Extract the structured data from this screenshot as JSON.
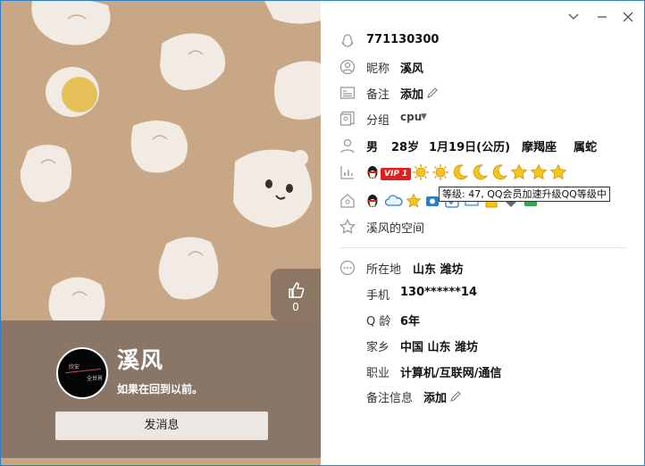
{
  "profile": {
    "qq_number": "771130300",
    "nickname_label": "昵称",
    "nickname": "溪风",
    "remark_label": "备注",
    "remark_action": "添加",
    "group_label": "分组",
    "group_value": "cpu",
    "gender": "男",
    "age": "28岁",
    "birthday": "1月19日(公历)",
    "zodiac": "摩羯座",
    "chinese_zodiac": "属蛇",
    "vip_badge": "VIP 1",
    "level_tooltip": "等级: 47, QQ会员加速升级QQ等级中",
    "space_link": "溪风的空间"
  },
  "details": {
    "location_label": "所在地",
    "location": "山东 潍坊",
    "phone_label": "手机",
    "phone": "130******14",
    "qage_label": "Q 龄",
    "qage": "6年",
    "hometown_label": "家乡",
    "hometown": "中国 山东 潍坊",
    "job_label": "职业",
    "job": "计算机/互联网/通信",
    "note_label": "备注信息",
    "note_action": "添加"
  },
  "card": {
    "nickname": "溪风",
    "signature": "如果在回到以前。",
    "send_button": "发消息",
    "like_count": "0",
    "avatar_text_1": "欣安",
    "avatar_text_2": "全世界"
  },
  "level_icons": [
    "sun-icon",
    "sun-icon",
    "moon-icon",
    "moon-icon",
    "moon-icon",
    "star-icon",
    "star-icon",
    "star-icon"
  ],
  "colors": {
    "accent": "#2d7ec2",
    "background_panel": "#c7a786",
    "card_bottom": "#8a7667",
    "vip_red": "#e02020"
  }
}
